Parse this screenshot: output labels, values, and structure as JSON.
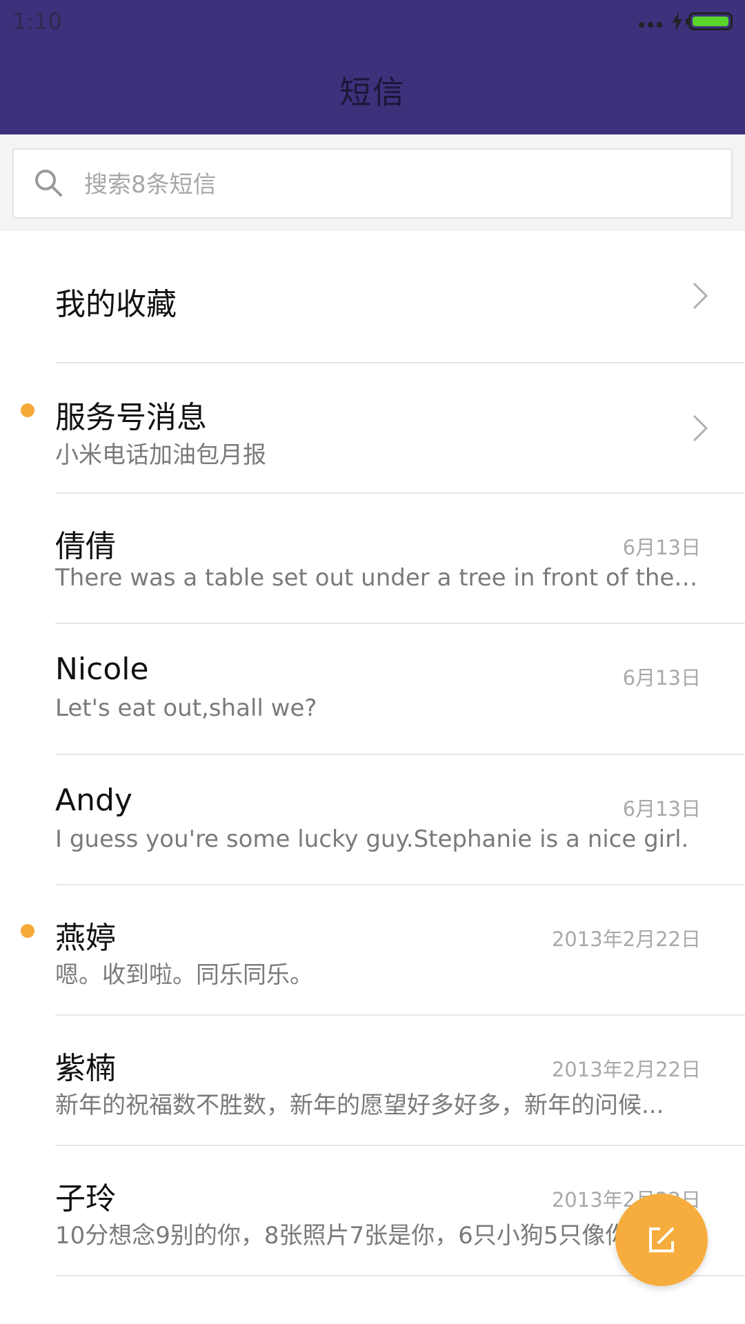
{
  "status_bar": {
    "time": "1:10"
  },
  "header": {
    "title": "短信"
  },
  "search": {
    "placeholder": "搜索8条短信"
  },
  "favorites": {
    "label": "我的收藏"
  },
  "service": {
    "title": "服务号消息",
    "subtitle": "小米电话加油包月报",
    "unread": true
  },
  "conversations": [
    {
      "name": "倩倩",
      "date": "6月13日",
      "preview": "There was a table set out under a tree in front of the ho...",
      "unread": false
    },
    {
      "name": "Nicole",
      "date": "6月13日",
      "preview": "Let's eat out,shall we?",
      "unread": false
    },
    {
      "name": "Andy",
      "date": "6月13日",
      "preview": "I guess you're some lucky guy.Stephanie is a nice girl.",
      "unread": false
    },
    {
      "name": "燕婷",
      "date": "2013年2月22日",
      "preview": "嗯。收到啦。同乐同乐。",
      "unread": true
    },
    {
      "name": "紫楠",
      "date": "2013年2月22日",
      "preview": "新年的祝福数不胜数，新年的愿望好多好多，新年的问候...",
      "unread": false
    },
    {
      "name": "子玲",
      "date": "2013年2月22日",
      "preview": "10分想念9别的你，8张照片7张是你，6只小狗5只像你...",
      "unread": false
    }
  ],
  "colors": {
    "header_bg": "#3d317c",
    "accent": "#f7ad3d",
    "unread_dot": "#f7a93a"
  },
  "icons": {
    "search": "search-icon",
    "chevron": "chevron-right-icon",
    "compose": "compose-icon"
  }
}
